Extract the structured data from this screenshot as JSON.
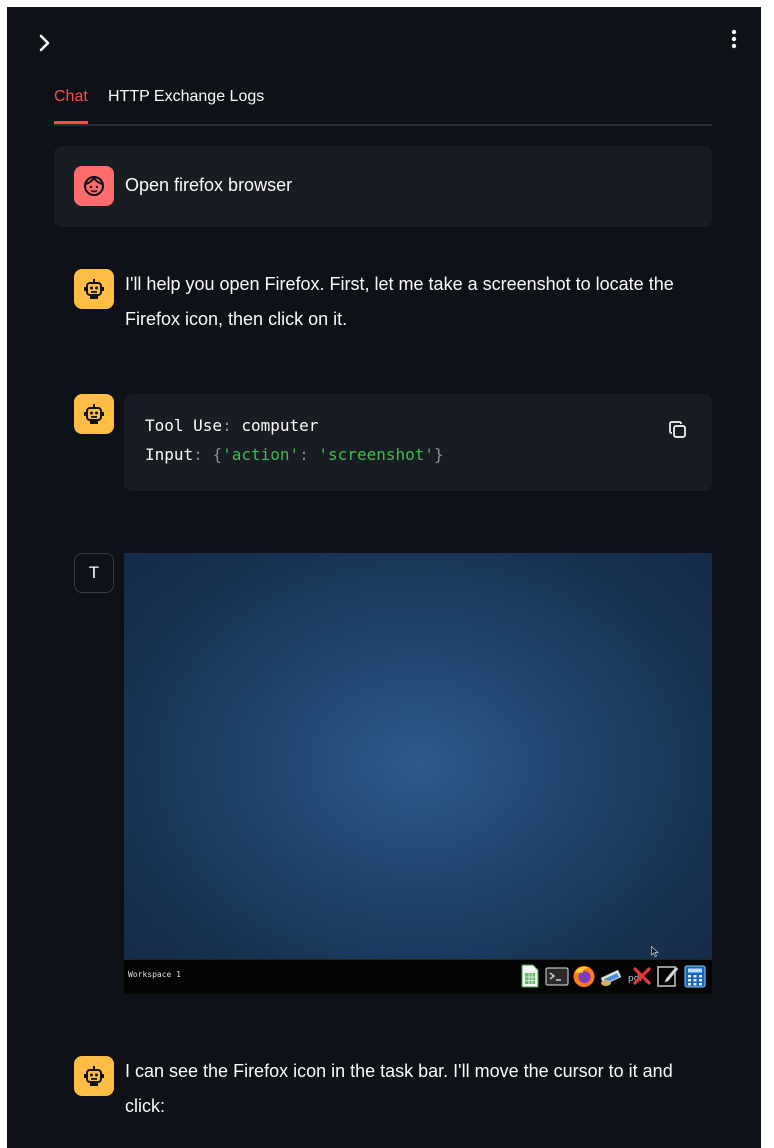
{
  "tabs": [
    {
      "label": "Chat",
      "active": true
    },
    {
      "label": "HTTP Exchange Logs",
      "active": false
    }
  ],
  "icons": {
    "expand": "chevron-right-icon",
    "menu": "vertical-dots-icon",
    "user_avatar": "face-icon",
    "bot_avatar": "robot-icon",
    "copy": "copy-icon"
  },
  "colors": {
    "background": "#0e1117",
    "accent": "#ff4b4b",
    "user_avatar": "#ff6c6c",
    "bot_avatar": "#ffbd45",
    "code_string": "#3dbb51"
  },
  "messages": {
    "user": {
      "text": "Open firefox browser"
    },
    "assistant_1": {
      "line1": "I'll help you open Firefox. First, let me take a screenshot to locate the",
      "line2": "Firefox icon, then click on it."
    },
    "tool_use": {
      "tool_label": "Tool Use",
      "tool_name": "computer",
      "input_label": "Input",
      "input_key": "'action'",
      "input_value": "'screenshot'"
    },
    "tool_result": {
      "avatar_letter": "T",
      "screenshot": {
        "workspace_label": "Workspace 1",
        "taskbar_icons": [
          "spreadsheet-icon",
          "terminal-icon",
          "firefox-icon",
          "image-viewer-icon",
          "pdf-icon",
          "close-x-icon",
          "text-editor-icon",
          "calculator-icon"
        ]
      }
    },
    "assistant_2": {
      "line1": "I can see the Firefox icon in the task bar. I'll move the cursor to it and",
      "line2": "click:"
    }
  }
}
